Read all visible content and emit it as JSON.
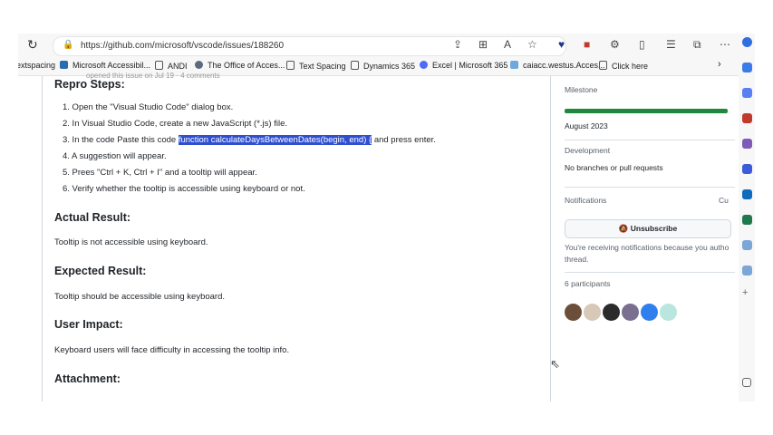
{
  "browser": {
    "url": "https://github.com/microsoft/vscode/issues/188260",
    "favorites": [
      "extspacing",
      "Microsoft Accessibil...",
      "ANDI",
      "The Office of Acces...",
      "Text Spacing",
      "Dynamics 365",
      "Excel | Microsoft 365",
      "caiacc.westus.Acces...",
      "Click here"
    ]
  },
  "issue": {
    "peek_text": "opened this issue on Jul 19 · 4 comments",
    "repro_heading": "Repro Steps:",
    "steps": [
      "1. Open the \"Visual Studio Code\" dialog box.",
      "2. In Visual Studio Code, create a new JavaScript (*.js) file.",
      "3. In the code Paste this code",
      "4. A suggestion will appear.",
      "5. Prees \"Ctrl + K, Ctrl + I\" and a tooltip will appear.",
      "6. Verify whether the tooltip is accessible using keyboard or not."
    ],
    "step3_code": "function calculateDaysBetweenDates(begin, end) {",
    "step3_tail": "and press enter.",
    "actual_heading": "Actual Result:",
    "actual_text": "Tooltip is not accessible using keyboard.",
    "expected_heading": "Expected Result:",
    "expected_text": "Tooltip should be accessible using keyboard.",
    "impact_heading": "User Impact:",
    "impact_text": "Keyboard users will face difficulty in accessing the tooltip info.",
    "attachment_heading": "Attachment:"
  },
  "sidebar": {
    "milestone_label": "Milestone",
    "milestone_value": "August 2023",
    "development_label": "Development",
    "development_value": "No branches or pull requests",
    "notifications_label": "Notifications",
    "customize": "Cu",
    "unsubscribe_label": "Unsubscribe",
    "notif_text_1": "You're receiving notifications because you autho",
    "notif_text_2": "thread.",
    "participants_label": "6 participants",
    "avatar_colors": [
      "#6b4f3a",
      "#d7c8b8",
      "#2b2b2b",
      "#7a6f8f",
      "#2f80ed",
      "#b9e6de"
    ]
  }
}
